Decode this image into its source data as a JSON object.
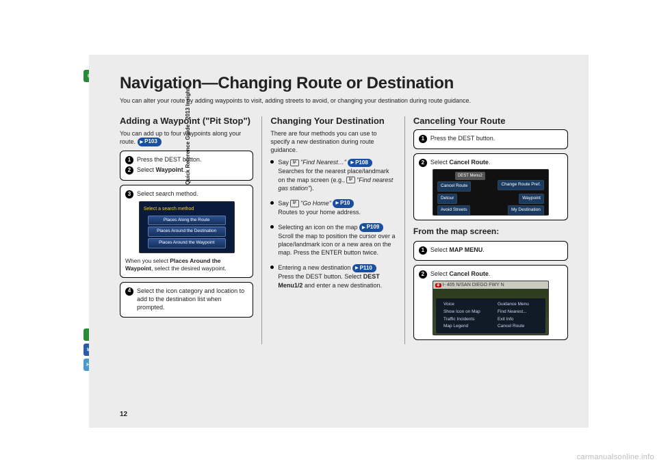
{
  "side_label": "Quick Reference Guide - 2013 Insight",
  "tabs": {
    "qrg": "QRG",
    "voice": "♪",
    "index": "Index",
    "home": "Home"
  },
  "title": "Navigation—Changing Route or Destination",
  "intro": "You can alter your route by adding waypoints to visit, adding streets to avoid, or changing your destination during route guidance.",
  "page_number": "12",
  "watermark": "carmanualsonline.info",
  "colA": {
    "heading": "Adding a Waypoint (\"Pit Stop\")",
    "p1_a": "You can add up to four waypoints along your route. ",
    "pill1": "P103",
    "box1": {
      "s1": "Press the DEST button.",
      "s2a": "Select ",
      "s2b": "Waypoint",
      "s2c": "."
    },
    "box2": {
      "s3": "Select search method.",
      "screen_title": "Select a search method",
      "opt1": "Places Along the Route",
      "opt2": "Places Around the Destination",
      "opt3": "Places Around the Waypoint",
      "note_a": "When you select ",
      "note_b": "Places Around the Waypoint",
      "note_c": ", select the desired waypoint."
    },
    "box3": {
      "s4": "Select the icon category and location to add to the destination list when prompted."
    }
  },
  "colB": {
    "heading": "Changing Your Destination",
    "p1": "There are four methods you can use to specify a new destination during route guidance.",
    "items": [
      {
        "pre": "Say ",
        "quote": "\"Find Nearest…\"",
        "pill": "P108",
        "after": "Searches for the nearest place/landmark on the map screen (e.g., ",
        "voice2": true,
        "quote2": "\"Find nearest gas station\"",
        "after2": ")."
      },
      {
        "pre": "Say ",
        "quote": "\"Go Home\"",
        "pill": "P10",
        "after": "Routes to your home address."
      },
      {
        "pre": "Selecting an icon on the map ",
        "pill": "P109",
        "after": "Scroll the map to position the cursor over a place/landmark icon or a new area on the map. Press the ENTER button twice."
      },
      {
        "pre": "Entering a new destination ",
        "pill": "P110",
        "after_a": "Press the DEST button. Select ",
        "after_b": "DEST Menu1/2",
        "after_c": " and enter a new destination."
      }
    ]
  },
  "colC": {
    "heading": "Canceling Your Route",
    "box1": {
      "s1": "Press the DEST button."
    },
    "box2": {
      "s2a": "Select ",
      "s2b": "Cancel Route",
      "s2c": ".",
      "labels": {
        "a": "Cancel Route",
        "b": "Change Route Pref.",
        "c": "Detour",
        "d": "Waypoint",
        "e": "Avoid Streets",
        "f": "My Destination",
        "top": "DEST Menu2"
      }
    },
    "sub2": "From the map screen:",
    "box3": {
      "s1a": "Select ",
      "s1b": "MAP MENU",
      "s1c": "."
    },
    "box4": {
      "s2a": "Select ",
      "s2b": "Cancel Route",
      "s2c": ".",
      "hdr": "I- 405 N/SAN DIEGO FWY N",
      "rows": [
        [
          "Voice",
          "Guidance Menu"
        ],
        [
          "Show Icon on Map",
          "Find Nearest..."
        ],
        [
          "Traffic Incidents",
          "Exit Info"
        ],
        [
          "Map Legend",
          "Cancel Route"
        ]
      ]
    }
  }
}
